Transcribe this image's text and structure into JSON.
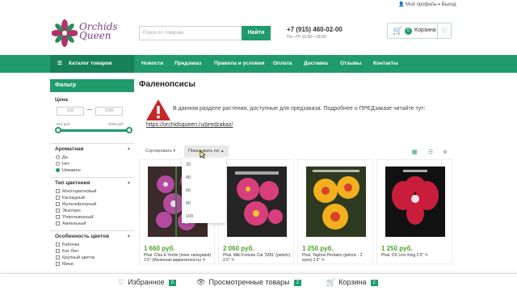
{
  "topbar": {
    "profile": "Мой профиль",
    "logout": "Выход"
  },
  "header": {
    "logo_line1": "Orchids",
    "logo_line2": "Queen",
    "search_placeholder": "Поиск по товарам",
    "search_button": "Найти",
    "phone": "+7 (915) 460-02-00",
    "hours": "Пн—Пт 10:00—18:00",
    "cart_count": "0",
    "cart_label": "Корзина"
  },
  "nav": {
    "catalog": "Каталог товаров",
    "items": [
      "Новости",
      "Предзаказ",
      "Правила и условия",
      "Оплата",
      "Доставка",
      "Отзывы",
      "Контакты"
    ]
  },
  "sidebar": {
    "filter": "Фильтр",
    "price": {
      "title": "Цена",
      "min_placeholder": "910",
      "max_placeholder": "3180",
      "min_label": "910 руб.",
      "max_label": "3180 руб."
    },
    "aroma": {
      "title": "Ароматная",
      "options": [
        "Да",
        "Нет",
        "Неважно"
      ],
      "selected": "Неважно"
    },
    "bloom": {
      "title": "Тип цветения",
      "options": [
        "Многоцветковый",
        "Каскадный",
        "Мультифлорный",
        "Экзотрис",
        "'Револьверный'",
        "Ампельный"
      ]
    },
    "flower": {
      "title": "Особенность цветов",
      "options": [
        "Бабочка",
        "Биг Лип",
        "Крупный цветок",
        "Мини"
      ]
    }
  },
  "main": {
    "title": "Фаленопсисы",
    "notice": "В данном разделе растения, доступные для предзаказа. Подробнее о ПРЕДзаказе читайте тут:",
    "link": "https://orchidsqueen.ru/predzakaz/",
    "sort_label": "Сортировать",
    "show_label": "Показывать по",
    "show_options": [
      "20",
      "40",
      "60",
      "80",
      "100"
    ],
    "products": [
      {
        "price": "1 660 руб.",
        "name": "Phal. Chia E Yenlin (inner variegated) 2.5\" (Иеленная вариегатность)"
      },
      {
        "price": "2 060 руб.",
        "name": "Phal. Miki Fortune Cat '3281' (peloric) 2.5\""
      },
      {
        "price": "1 250 руб.",
        "name": "Phal. Yaphon Perbalm (peloric - 2 eyes) 2.5\""
      },
      {
        "price": "1 250 руб.",
        "name": "Phal. OX Lion King 2.5\""
      }
    ]
  },
  "bottombar": {
    "favorites": "Избранное",
    "favorites_count": "0",
    "viewed": "Просмотренные товары",
    "viewed_count": "2",
    "cart": "Корзина",
    "cart_count": "2"
  },
  "colors": {
    "brand": "#1f9b6c",
    "price": "#4aa32f",
    "warn": "#c62828"
  }
}
